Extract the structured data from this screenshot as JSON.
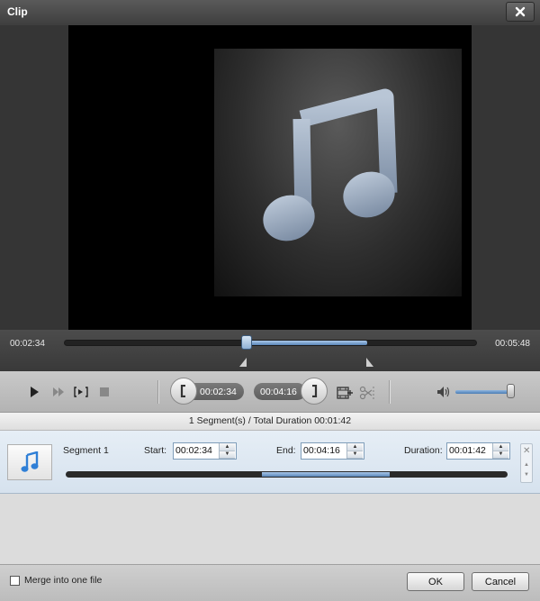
{
  "window": {
    "title": "Clip"
  },
  "preview": {
    "media_type_icon": "music-note-icon"
  },
  "timeline": {
    "current_time": "00:02:34",
    "total_time": "00:05:48",
    "selection_start_fraction": 0.443,
    "selection_end_fraction": 0.733
  },
  "controls": {
    "icons": [
      "play-icon",
      "fast-forward-icon",
      "frame-step-icon",
      "stop-icon",
      "set-start-icon",
      "set-end-icon",
      "add-clip-icon",
      "scissors-icon",
      "volume-icon"
    ],
    "start_time": "00:02:34",
    "end_time": "00:04:16",
    "volume_fraction": 0.92
  },
  "segments_summary": "1 Segment(s) / Total Duration 00:01:42",
  "segment": {
    "name": "Segment 1",
    "start_label": "Start:",
    "start_value": "00:02:34",
    "end_label": "End:",
    "end_value": "00:04:16",
    "duration_label": "Duration:",
    "duration_value": "00:01:42"
  },
  "footer": {
    "merge_label": "Merge into one file",
    "merge_checked": false,
    "ok_label": "OK",
    "cancel_label": "Cancel"
  },
  "colors": {
    "accent": "#5a86b8"
  }
}
